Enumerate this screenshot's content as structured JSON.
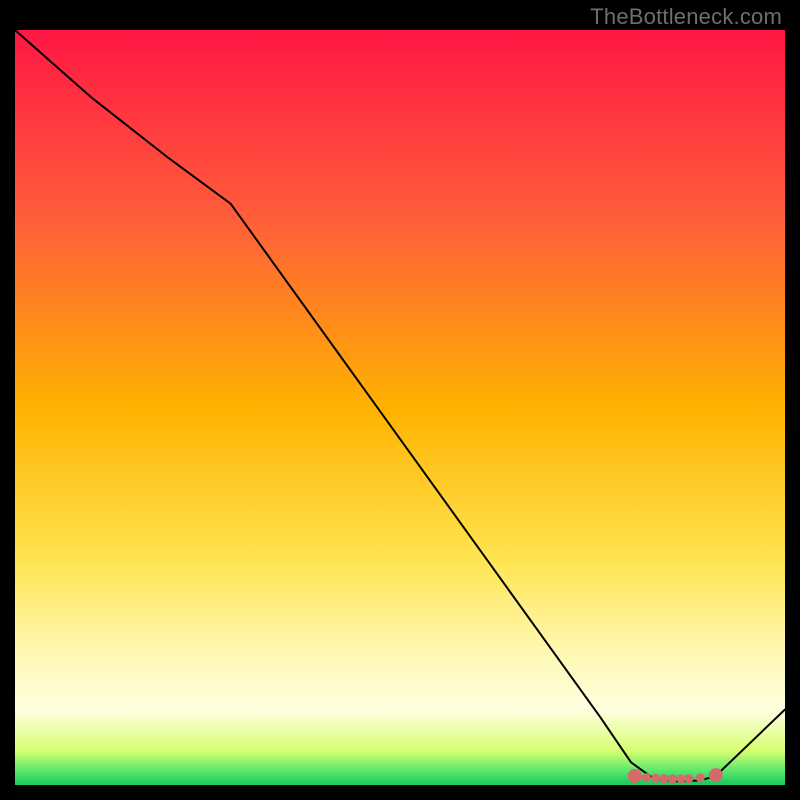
{
  "attribution": "TheBottleneck.com",
  "chart_data": {
    "type": "line",
    "title": "",
    "xlabel": "",
    "ylabel": "",
    "xlim": [
      0,
      100
    ],
    "ylim": [
      0,
      100
    ],
    "background_gradient": {
      "type": "vertical",
      "stops": [
        {
          "pos": 0.0,
          "color": "#ff1744"
        },
        {
          "pos": 0.25,
          "color": "#ff5e3a"
        },
        {
          "pos": 0.5,
          "color": "#ffb200"
        },
        {
          "pos": 0.7,
          "color": "#ffe450"
        },
        {
          "pos": 0.82,
          "color": "#fff8b0"
        },
        {
          "pos": 0.9,
          "color": "#ffffe0"
        },
        {
          "pos": 0.955,
          "color": "#d6ff70"
        },
        {
          "pos": 0.98,
          "color": "#5fe86e"
        },
        {
          "pos": 1.0,
          "color": "#18c95a"
        }
      ]
    },
    "series": [
      {
        "name": "bottleneck-curve",
        "color": "#000000",
        "width": 2,
        "x": [
          0,
          10,
          20,
          28,
          40,
          52,
          64,
          76,
          80,
          83,
          86,
          89,
          91,
          100
        ],
        "y": [
          100,
          91,
          83,
          77,
          60,
          43,
          26,
          9,
          3,
          0.8,
          0.5,
          0.6,
          1.2,
          10
        ]
      }
    ],
    "markers": {
      "name": "optimal-zone",
      "color": "#d46a6a",
      "radius_primary": 7,
      "radius_secondary": 4.5,
      "points": [
        {
          "x": 80.5,
          "y": 1.2,
          "r": "primary"
        },
        {
          "x": 82.0,
          "y": 1.0,
          "r": "secondary"
        },
        {
          "x": 83.2,
          "y": 0.9,
          "r": "secondary"
        },
        {
          "x": 84.3,
          "y": 0.85,
          "r": "secondary"
        },
        {
          "x": 85.4,
          "y": 0.82,
          "r": "secondary"
        },
        {
          "x": 86.5,
          "y": 0.82,
          "r": "secondary"
        },
        {
          "x": 87.5,
          "y": 0.85,
          "r": "secondary"
        },
        {
          "x": 89.0,
          "y": 0.95,
          "r": "secondary"
        },
        {
          "x": 91.0,
          "y": 1.3,
          "r": "primary"
        }
      ]
    }
  }
}
